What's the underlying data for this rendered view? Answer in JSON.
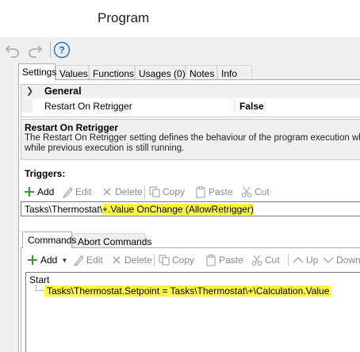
{
  "window": {
    "title": "Program"
  },
  "toolbar": {
    "undo_icon": "undo-icon",
    "redo_icon": "redo-icon",
    "help_icon": "help-icon"
  },
  "tabs": [
    {
      "label": "Settings",
      "active": true
    },
    {
      "label": "Values"
    },
    {
      "label": "Functions"
    },
    {
      "label": "Usages (0)"
    },
    {
      "label": "Notes"
    },
    {
      "label": "Info"
    }
  ],
  "property_grid": {
    "category": "General",
    "rows": [
      {
        "name": "Restart On Retrigger",
        "value": "False"
      }
    ]
  },
  "description": {
    "title": "Restart On Retrigger",
    "body": "The Restart On Retrigger setting defines the behaviour of the program execution when while previous execution is still running."
  },
  "triggers": {
    "label": "Triggers:",
    "actions": {
      "add": "Add",
      "edit": "Edit",
      "delete": "Delete",
      "copy": "Copy",
      "paste": "Paste",
      "cut": "Cut"
    },
    "item": {
      "prefix": "Tasks\\Thermostat\\",
      "highlight": "+.Value OnChange (AllowRetrigger)"
    }
  },
  "commands": {
    "tabs": [
      {
        "label": "Commands",
        "active": true
      },
      {
        "label": "Abort Commands"
      }
    ],
    "actions": {
      "add": "Add",
      "edit": "Edit",
      "delete": "Delete",
      "copy": "Copy",
      "paste": "Paste",
      "cut": "Cut",
      "up": "Up",
      "down": "Down"
    },
    "tree": {
      "root": "Start",
      "child": "Tasks\\Thermostat.Setpoint = Tasks\\Thermostat\\+\\Calculation.Value"
    }
  },
  "colors": {
    "highlight": "#fff740",
    "add_green": "#2e9e2e",
    "help_blue": "#1f6fd1"
  }
}
